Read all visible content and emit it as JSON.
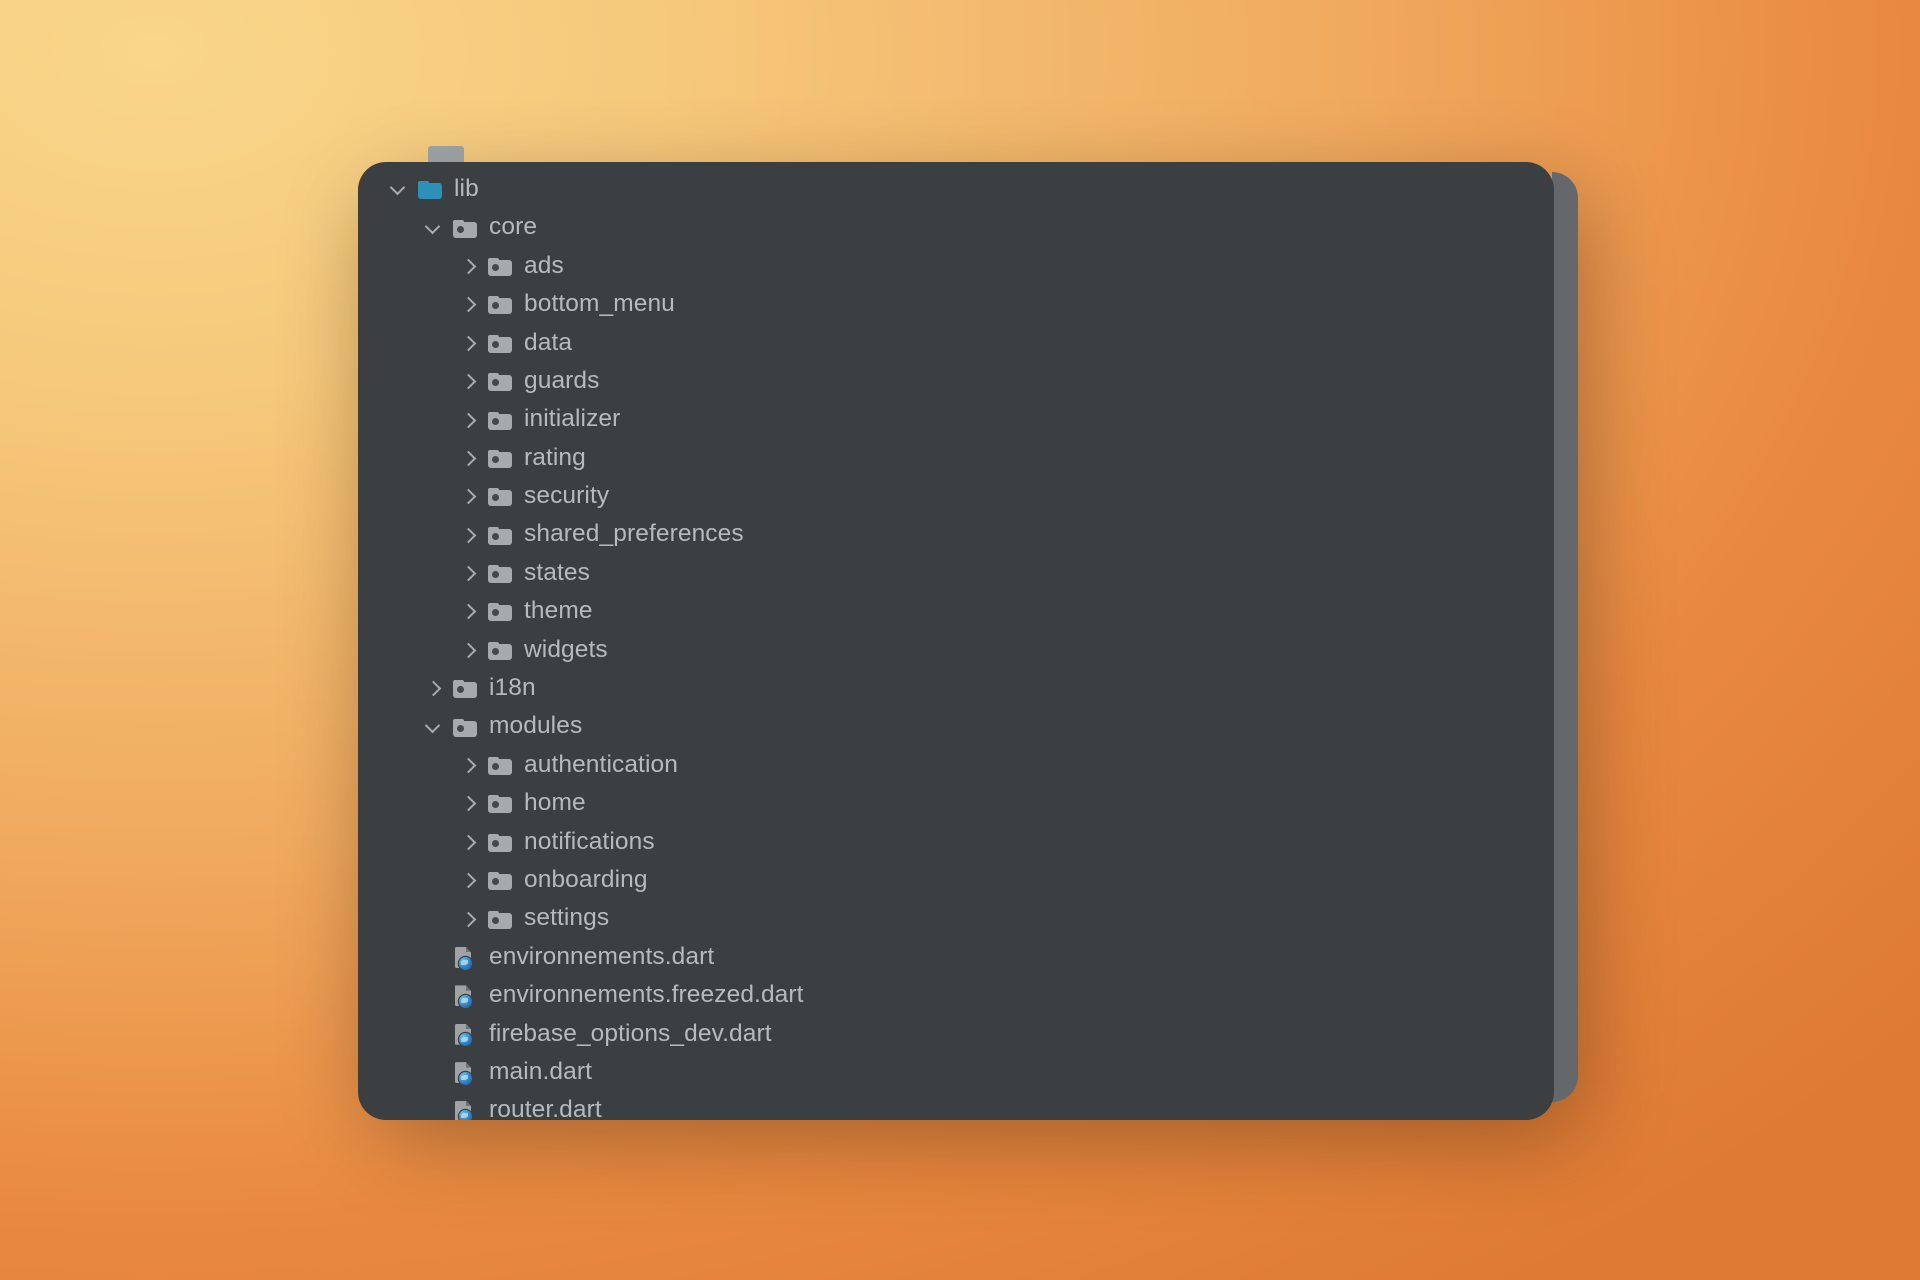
{
  "window": {
    "panel_background": "#3C3F41",
    "panel_edge_color": "#65686B",
    "text_color": "#B6BABD",
    "source_root_color": "#2E90B8",
    "wallpaper_from": "#F9D68A",
    "wallpaper_to": "#DE7A33"
  },
  "file_tree": {
    "rows": [
      {
        "label": "lib",
        "depth": 0,
        "type": "folder",
        "icon": "folder-source-root-icon",
        "state": "expanded"
      },
      {
        "label": "core",
        "depth": 1,
        "type": "folder",
        "icon": "folder-icon",
        "state": "expanded"
      },
      {
        "label": "ads",
        "depth": 2,
        "type": "folder",
        "icon": "folder-icon",
        "state": "collapsed"
      },
      {
        "label": "bottom_menu",
        "depth": 2,
        "type": "folder",
        "icon": "folder-icon",
        "state": "collapsed"
      },
      {
        "label": "data",
        "depth": 2,
        "type": "folder",
        "icon": "folder-icon",
        "state": "collapsed"
      },
      {
        "label": "guards",
        "depth": 2,
        "type": "folder",
        "icon": "folder-icon",
        "state": "collapsed"
      },
      {
        "label": "initializer",
        "depth": 2,
        "type": "folder",
        "icon": "folder-icon",
        "state": "collapsed"
      },
      {
        "label": "rating",
        "depth": 2,
        "type": "folder",
        "icon": "folder-icon",
        "state": "collapsed"
      },
      {
        "label": "security",
        "depth": 2,
        "type": "folder",
        "icon": "folder-icon",
        "state": "collapsed"
      },
      {
        "label": "shared_preferences",
        "depth": 2,
        "type": "folder",
        "icon": "folder-icon",
        "state": "collapsed"
      },
      {
        "label": "states",
        "depth": 2,
        "type": "folder",
        "icon": "folder-icon",
        "state": "collapsed"
      },
      {
        "label": "theme",
        "depth": 2,
        "type": "folder",
        "icon": "folder-icon",
        "state": "collapsed"
      },
      {
        "label": "widgets",
        "depth": 2,
        "type": "folder",
        "icon": "folder-icon",
        "state": "collapsed"
      },
      {
        "label": "i18n",
        "depth": 1,
        "type": "folder",
        "icon": "folder-icon",
        "state": "collapsed"
      },
      {
        "label": "modules",
        "depth": 1,
        "type": "folder",
        "icon": "folder-icon",
        "state": "expanded"
      },
      {
        "label": "authentication",
        "depth": 2,
        "type": "folder",
        "icon": "folder-icon",
        "state": "collapsed"
      },
      {
        "label": "home",
        "depth": 2,
        "type": "folder",
        "icon": "folder-icon",
        "state": "collapsed"
      },
      {
        "label": "notifications",
        "depth": 2,
        "type": "folder",
        "icon": "folder-icon",
        "state": "collapsed"
      },
      {
        "label": "onboarding",
        "depth": 2,
        "type": "folder",
        "icon": "folder-icon",
        "state": "collapsed"
      },
      {
        "label": "settings",
        "depth": 2,
        "type": "folder",
        "icon": "folder-icon",
        "state": "collapsed"
      },
      {
        "label": "environnements.dart",
        "depth": 1,
        "type": "file",
        "icon": "dart-file-icon",
        "state": "leaf"
      },
      {
        "label": "environnements.freezed.dart",
        "depth": 1,
        "type": "file",
        "icon": "dart-file-icon",
        "state": "leaf"
      },
      {
        "label": "firebase_options_dev.dart",
        "depth": 1,
        "type": "file",
        "icon": "dart-file-icon",
        "state": "leaf"
      },
      {
        "label": "main.dart",
        "depth": 1,
        "type": "file",
        "icon": "dart-file-icon",
        "state": "leaf"
      },
      {
        "label": "router.dart",
        "depth": 1,
        "type": "file",
        "icon": "dart-file-icon",
        "state": "leaf"
      }
    ]
  }
}
